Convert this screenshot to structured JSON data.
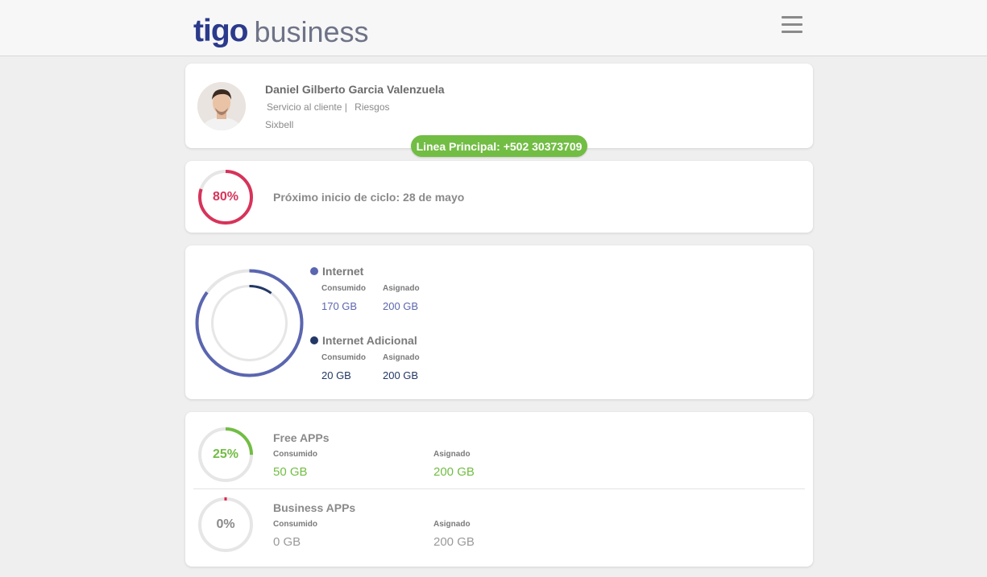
{
  "header": {
    "logo_primary": "tigo",
    "logo_secondary": "business",
    "menu_icon": "hamburger-menu-icon"
  },
  "profile": {
    "name": "Daniel Gilberto Garcia Valenzuela",
    "department": "Servicio al cliente |",
    "area": "Riesgos",
    "company": "Sixbell",
    "main_line": "Linea Principal: +502 30373709"
  },
  "cycle": {
    "percent_label": "80%",
    "percent_value": 0.8,
    "next_cycle": "Próximo inicio de ciclo: 28 de mayo",
    "color": "#d7335a"
  },
  "internet": {
    "ring_total_fraction": 0.85,
    "ring_additional_fraction": 0.1,
    "items": [
      {
        "name": "Internet",
        "color": "#5b66b0",
        "consumed_label": "Consumido",
        "consumed": "170 GB",
        "assigned_label": "Asignado",
        "assigned": "200 GB"
      },
      {
        "name": "Internet Adicional",
        "color": "#233866",
        "consumed_label": "Consumido",
        "consumed": "20 GB",
        "assigned_label": "Asignado",
        "assigned": "200 GB"
      }
    ]
  },
  "apps": [
    {
      "percent_label": "25%",
      "percent_value": 0.25,
      "title": "Free APPs",
      "consumed_label": "Consumido",
      "consumed": "50 GB",
      "assigned_label": "Asignado",
      "assigned": "200 GB",
      "color": "#72bd44"
    },
    {
      "percent_label": "0%",
      "percent_value": 0.0,
      "title": "Business APPs",
      "consumed_label": "Consumido",
      "consumed": "0 GB",
      "assigned_label": "Asignado",
      "assigned": "200 GB",
      "color": "#e0244c"
    }
  ]
}
